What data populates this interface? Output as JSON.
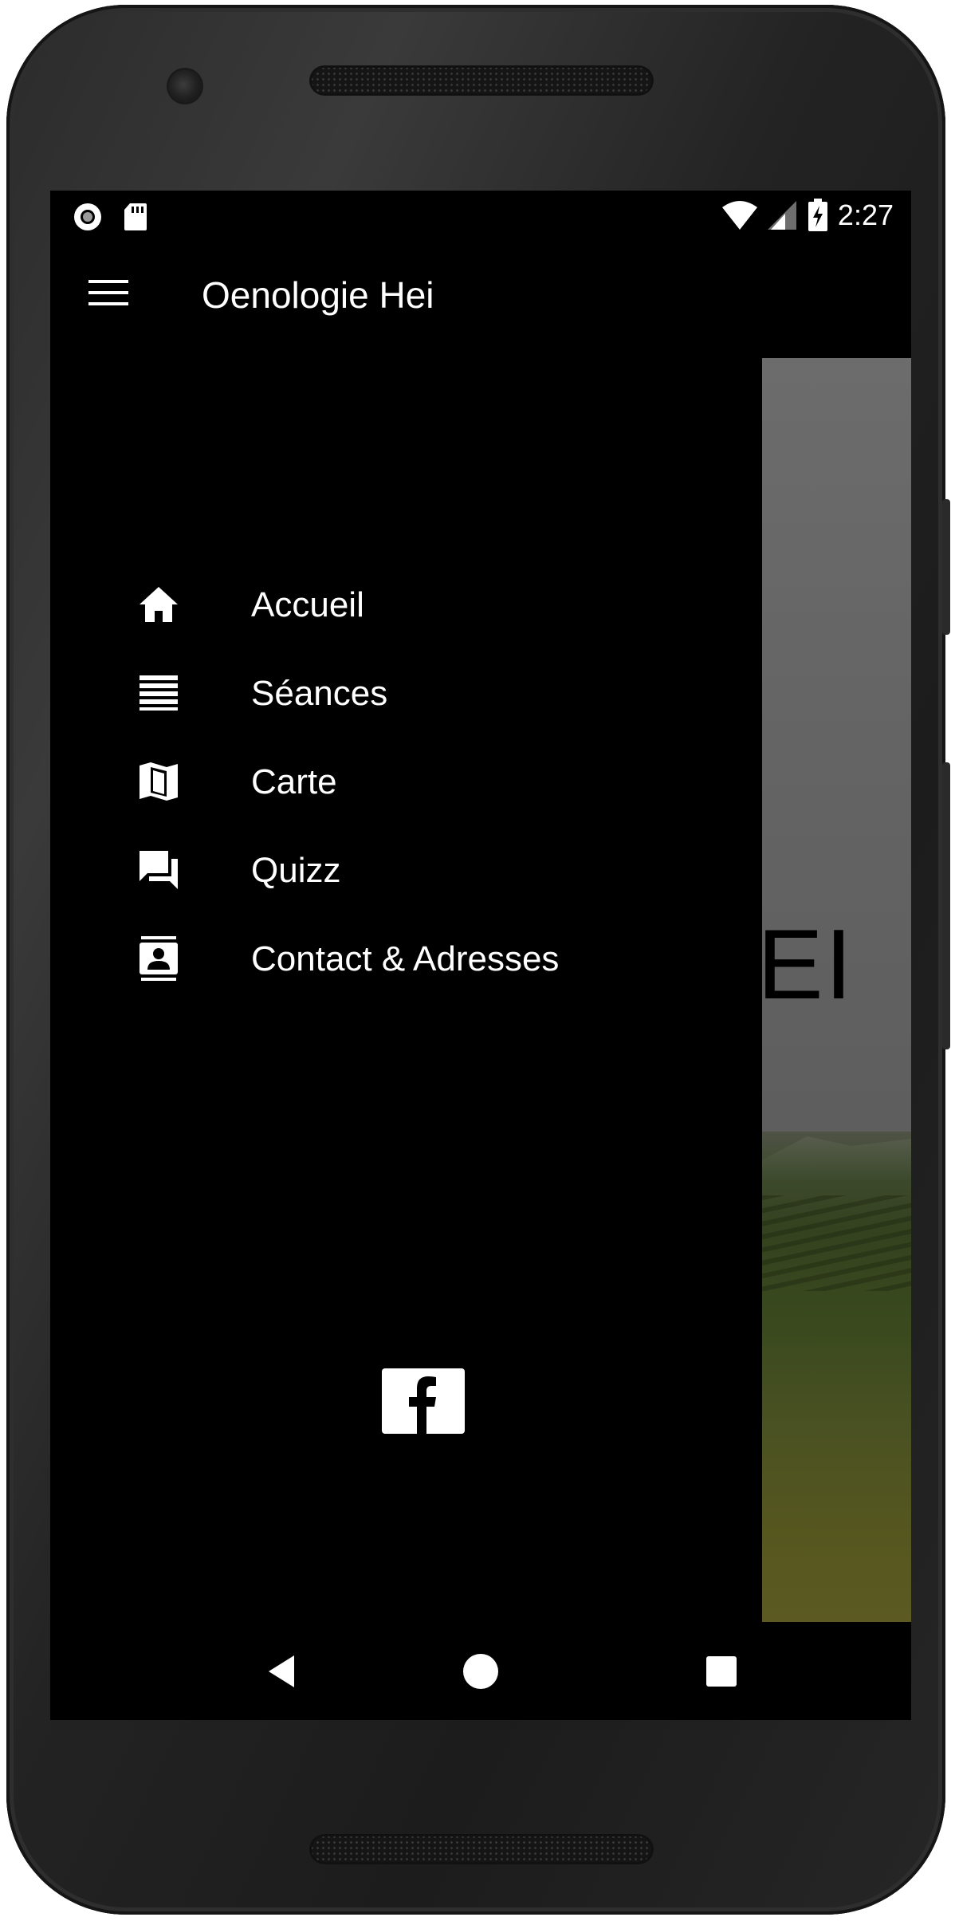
{
  "status_bar": {
    "time": "2:27",
    "left_icons": [
      "record-circle-icon",
      "sd-card-icon"
    ],
    "right_icons": [
      "wifi-icon",
      "cell-signal-icon",
      "battery-charging-icon"
    ]
  },
  "app_bar": {
    "title": "Oenologie Hei",
    "menu_icon": "hamburger-menu-icon"
  },
  "drawer": {
    "items": [
      {
        "label": "Accueil",
        "icon": "home-icon"
      },
      {
        "label": "Séances",
        "icon": "list-icon"
      },
      {
        "label": "Carte",
        "icon": "map-icon"
      },
      {
        "label": "Quizz",
        "icon": "forum-icon"
      },
      {
        "label": "Contact & Adresses",
        "icon": "contacts-icon"
      }
    ],
    "social": {
      "icon": "facebook-icon"
    }
  },
  "background_content": {
    "visible_text": "EI"
  },
  "nav_bar": {
    "buttons": [
      "back-icon",
      "home-circle-icon",
      "recents-icon"
    ]
  },
  "colors": {
    "drawer_background": "#000000",
    "text": "#ffffff",
    "phone_body": "#2b2b2b"
  }
}
